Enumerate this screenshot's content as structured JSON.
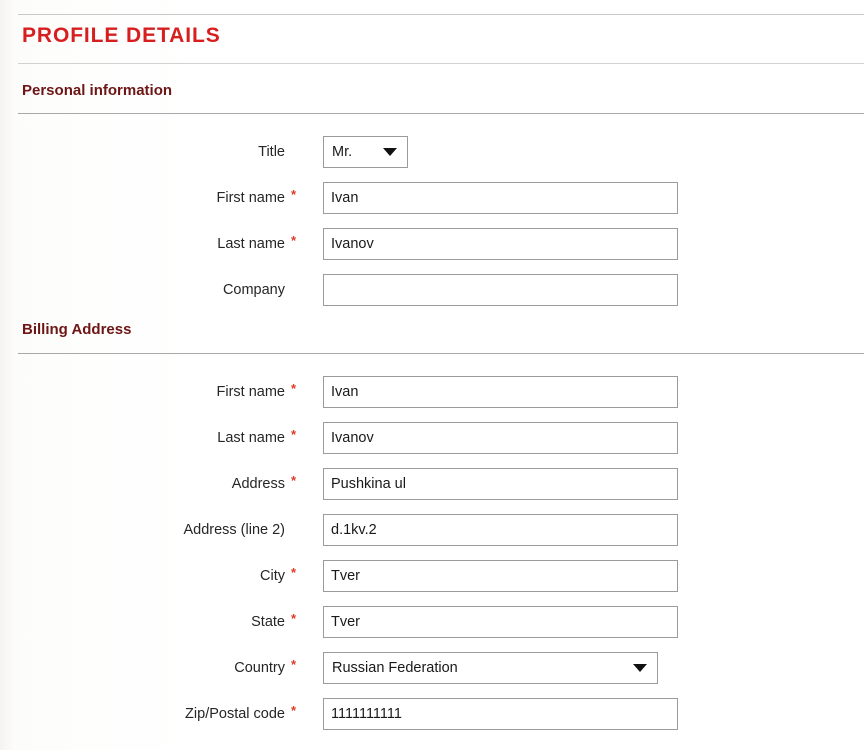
{
  "page": {
    "title": "PROFILE DETAILS",
    "title_color": "#d81f1f",
    "section_heading_color": "#6e1616",
    "required_marker": "*",
    "required_marker_color": "#e03a2a"
  },
  "sections": [
    {
      "heading": "Personal information",
      "fields": [
        {
          "label": "Title",
          "type": "select",
          "value": "Mr.",
          "required": false
        },
        {
          "label": "First name",
          "type": "text",
          "value": "Ivan",
          "required": true
        },
        {
          "label": "Last name",
          "type": "text",
          "value": "Ivanov",
          "required": true
        },
        {
          "label": "Company",
          "type": "text",
          "value": "",
          "required": false
        }
      ]
    },
    {
      "heading": "Billing Address",
      "fields": [
        {
          "label": "First name",
          "type": "text",
          "value": "Ivan",
          "required": true
        },
        {
          "label": "Last name",
          "type": "text",
          "value": "Ivanov",
          "required": true
        },
        {
          "label": "Address",
          "type": "text",
          "value": "Pushkina ul",
          "required": true
        },
        {
          "label": "Address (line 2)",
          "type": "text",
          "value": "d.1kv.2",
          "required": false
        },
        {
          "label": "City",
          "type": "text",
          "value": "Tver",
          "required": true
        },
        {
          "label": "State",
          "type": "text",
          "value": "Tver",
          "required": true
        },
        {
          "label": "Country",
          "type": "select",
          "value": "Russian Federation",
          "required": true
        },
        {
          "label": "Zip/Postal code",
          "type": "text",
          "value": "1111111111",
          "required": true
        }
      ]
    }
  ],
  "icons": {
    "dropdown_caret": "chevron-down-icon"
  }
}
